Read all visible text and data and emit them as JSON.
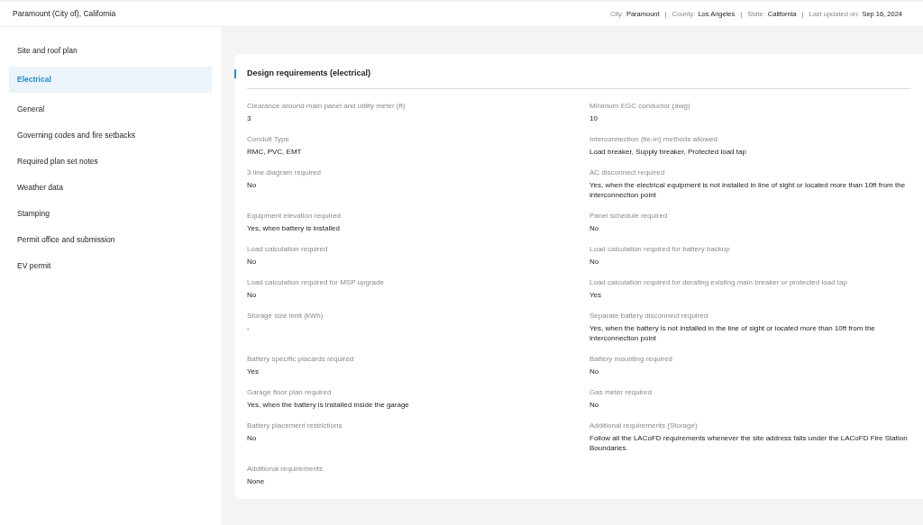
{
  "header": {
    "title": "Paramount (City of), California",
    "separator": "|",
    "meta": [
      {
        "label": "City:",
        "value": "Paramount"
      },
      {
        "label": "County:",
        "value": "Los Angeles"
      },
      {
        "label": "State:",
        "value": "California"
      },
      {
        "label": "Last updated on:",
        "value": "Sep 16, 2024"
      }
    ]
  },
  "sidebar": {
    "items": [
      {
        "label": "Site and roof plan",
        "selected": false
      },
      {
        "label": "Electrical",
        "selected": true
      },
      {
        "label": "General",
        "selected": false
      },
      {
        "label": "Governing codes and fire setbacks",
        "selected": false
      },
      {
        "label": "Required plan set notes",
        "selected": false
      },
      {
        "label": "Weather data",
        "selected": false
      },
      {
        "label": "Stamping",
        "selected": false
      },
      {
        "label": "Permit office and submission",
        "selected": false
      },
      {
        "label": "EV permit",
        "selected": false
      }
    ]
  },
  "section": {
    "title": "Design requirements (electrical)",
    "rows": [
      [
        {
          "label": "Clearance around main panel and utility meter (ft)",
          "value": "3"
        },
        {
          "label": "Minimum EGC conductor (awg)",
          "value": "10"
        }
      ],
      [
        {
          "label": "Conduit Type",
          "value": "RMC, PVC, EMT"
        },
        {
          "label": "Interconnection (tie-in) methods allowed",
          "value": "Load breaker, Supply breaker, Protected load tap"
        }
      ],
      [
        {
          "label": "3 line diagram required",
          "value": "No"
        },
        {
          "label": "AC disconnect required",
          "value": "Yes, when the electrical equipment is not installed in line of sight or located more than 10ft from the interconnection point"
        }
      ],
      [
        {
          "label": "Equipment elevation required",
          "value": "Yes, when battery is installed"
        },
        {
          "label": "Panel schedule required",
          "value": "No"
        }
      ],
      [
        {
          "label": "Load calculation required",
          "value": "No"
        },
        {
          "label": "Load calculation required for battery backup",
          "value": "No"
        }
      ],
      [
        {
          "label": "Load calculation required for MSP upgrade",
          "value": "No"
        },
        {
          "label": "Load calculation required for derating existing main breaker or protected load tap",
          "value": "Yes"
        }
      ],
      [
        {
          "label": "Storage size limit (kWh)",
          "value": "-"
        },
        {
          "label": "Separate battery disconnect required",
          "value": "Yes, when the battery is not installed in the line of sight or located more than 10ft from the interconnection point"
        }
      ],
      [
        {
          "label": "Battery specific placards required",
          "value": "Yes"
        },
        {
          "label": "Battery mounting required",
          "value": "No"
        }
      ],
      [
        {
          "label": "Garage floor plan required",
          "value": "Yes, when the battery is installed inside the garage"
        },
        {
          "label": "Gas meter required",
          "value": "No"
        }
      ],
      [
        {
          "label": "Battery placement restrictions",
          "value": "No"
        },
        {
          "label": "Additional requirements (Storage)",
          "value": "Follow all the LACoFD requirements whenever the site address falls under the LACoFD Fire Station Boundaries."
        }
      ],
      [
        {
          "label": "Additional requirements",
          "value": "None"
        }
      ]
    ]
  }
}
